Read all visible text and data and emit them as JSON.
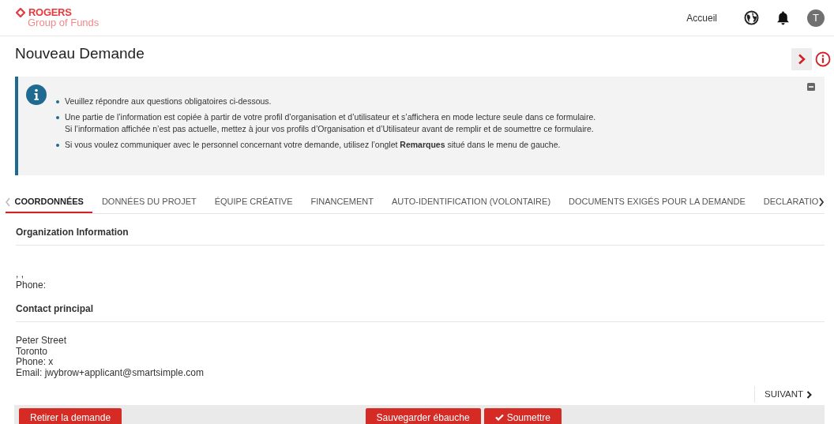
{
  "header": {
    "logo_top": "ROGERS",
    "logo_bottom": "Group of Funds",
    "nav_link": "Accueil",
    "avatar": "T"
  },
  "page_title": "Nouveau Demande",
  "notice": {
    "items": [
      {
        "lines": [
          "Veuillez répondre aux questions obligatoires ci-dessous."
        ]
      },
      {
        "lines": [
          "Une partie de l’information est copiée à partir de votre profil d’organisation et d’utilisateur et s’affichera en mode lecture seule dans ce formulaire.",
          "Si l’information affichée n’est pas actuelle, mettez à jour vos profils d’Organisation et d’Utilisateur avant de remplir et de soumettre ce formulaire."
        ]
      },
      {
        "lines": [
          "Si vous voulez communiquer avec le personnel concernant votre demande, utilisez l’onglet **Remarques** situé dans le menu de gauche."
        ]
      }
    ]
  },
  "tabs": [
    {
      "label": "COORDONNÉES",
      "selected": true
    },
    {
      "label": "DONNÉES DU PROJET",
      "selected": false
    },
    {
      "label": "ÉQUIPE CRÉATIVE",
      "selected": false
    },
    {
      "label": "FINANCEMENT",
      "selected": false
    },
    {
      "label": "AUTO-IDENTIFICATION (VOLONTAIRE)",
      "selected": false
    },
    {
      "label": "DOCUMENTS EXIGÉS POUR LA DEMANDE",
      "selected": false
    },
    {
      "label": "DECLARATIO",
      "selected": false
    }
  ],
  "sections": [
    {
      "title": "Organization Information",
      "lines": [
        ", ,",
        "Phone:"
      ]
    },
    {
      "title": "Contact principal",
      "lines": [
        "Peter Street",
        "Toronto",
        "Phone: x",
        "Email: jwybrow+applicant@smartsimple.com"
      ]
    }
  ],
  "next_button": "SUIVANT",
  "footer_buttons": [
    {
      "label": "Retirer la demande",
      "kind": "withdraw"
    },
    {
      "label": "Sauvegarder ébauche",
      "kind": "save"
    },
    {
      "label": "Soumettre",
      "kind": "submit"
    }
  ]
}
